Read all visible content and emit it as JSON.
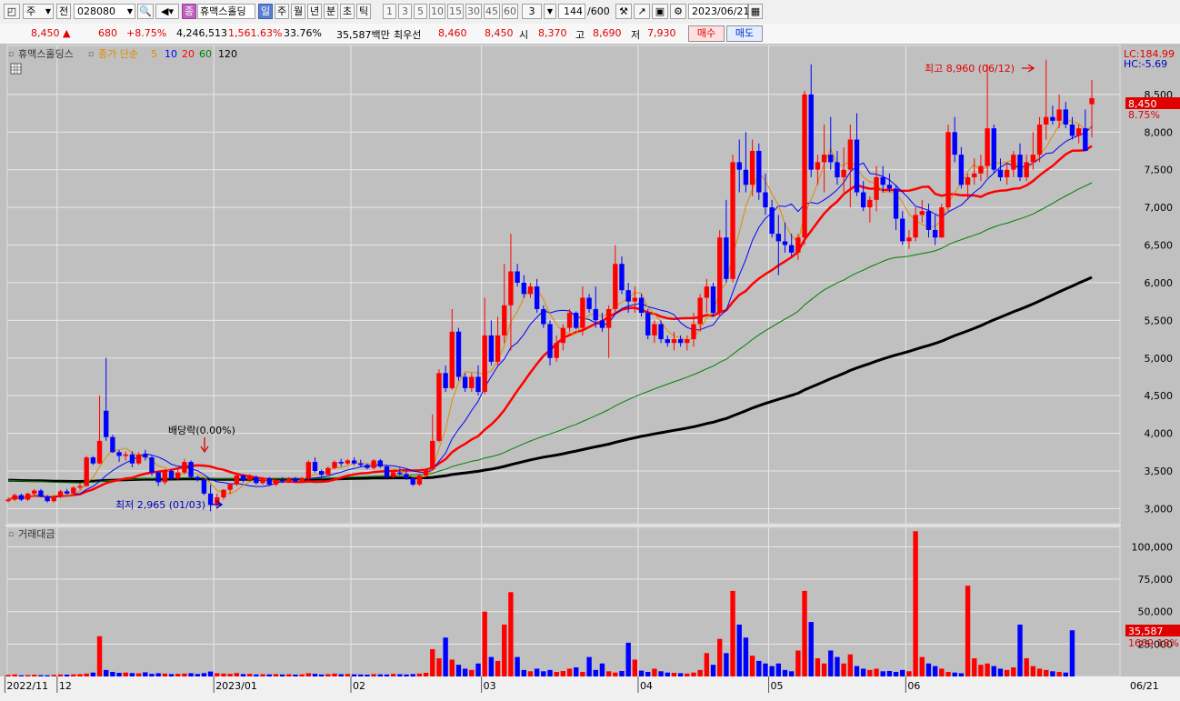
{
  "toolbar": {
    "market": "주",
    "prev_label": "전",
    "stock_code": "028080",
    "stock_badge": "종",
    "stock_name": "휴맥스홀딩",
    "periods": [
      "일",
      "주",
      "월",
      "년",
      "분",
      "초",
      "틱"
    ],
    "active_period": "일",
    "minute_steps": [
      "1",
      "3",
      "5",
      "10",
      "15",
      "30",
      "45",
      "60"
    ],
    "extra_step": "3",
    "count_value": "144",
    "count_total": "/600",
    "date": "2023/06/21"
  },
  "quote": {
    "price": "8,450",
    "arrow": "▲",
    "change": "680",
    "change_pct": "+8.75%",
    "volume": "4,246,513",
    "volume_ratio": "1,561.63%",
    "turnover": "33.76%",
    "amount": "35,587백만",
    "best_label": "최우선",
    "best_ask": "8,460",
    "best_bid": "8,450",
    "open_label": "시",
    "open": "8,370",
    "high_label": "고",
    "high": "8,690",
    "low_label": "저",
    "low": "7,930",
    "buy_label": "매수",
    "sell_label": "매도"
  },
  "price_panel": {
    "stock_name": "휴맥스홀딩스",
    "ma_label": "종가 단순",
    "ma_periods": [
      "5",
      "10",
      "20",
      "60",
      "120"
    ],
    "lc_label": "LC:184.99",
    "hc_label": "HC:-5.69",
    "last_price_tag": "8,450",
    "last_pct_tag": "8.75%",
    "max_annotation": "최고 8,960 (06/12)",
    "min_annotation": "최저 2,965 (01/03)",
    "dividend_annotation": "배당락(0.00%)",
    "y_ticks": [
      "3,000",
      "3,500",
      "4,000",
      "4,500",
      "5,000",
      "5,500",
      "6,000",
      "6,500",
      "7,000",
      "7,500",
      "8,000",
      "8,500"
    ]
  },
  "volume_panel": {
    "title": "거래대금",
    "y_ticks": [
      "25,000",
      "50,000",
      "75,000",
      "100,000"
    ],
    "last_tag": "35,587",
    "last_pct": "1669.18%"
  },
  "x_axis": {
    "labels": [
      "2022/11",
      "12",
      "2023/01",
      "02",
      "03",
      "04",
      "05",
      "06"
    ],
    "right_label": "06/21"
  },
  "colors": {
    "up": "#ff0000",
    "down": "#0000ff",
    "ma5": "#e08a00",
    "ma10": "#0000ff",
    "ma20": "#ff0000",
    "ma60": "#008000",
    "ma120": "#000000",
    "background": "#c0c0c0"
  },
  "chart_data": [
    {
      "type": "candlestick",
      "title": "휴맥스홀딩스",
      "ylim": [
        2800,
        9150
      ],
      "y_ticks": [
        3000,
        3500,
        4000,
        4500,
        5000,
        5500,
        6000,
        6500,
        7000,
        7500,
        8000,
        8500
      ],
      "x_labels": [
        "2022/11",
        "12",
        "2023/01",
        "02",
        "03",
        "04",
        "05",
        "06"
      ],
      "x_label_candle_index": [
        0,
        8,
        32,
        53,
        73,
        97,
        117,
        138
      ],
      "candles": [
        [
          3100,
          3150,
          3080,
          3120
        ],
        [
          3120,
          3200,
          3100,
          3180
        ],
        [
          3180,
          3200,
          3100,
          3120
        ],
        [
          3120,
          3210,
          3100,
          3200
        ],
        [
          3200,
          3260,
          3180,
          3240
        ],
        [
          3240,
          3260,
          3150,
          3160
        ],
        [
          3160,
          3180,
          3080,
          3100
        ],
        [
          3100,
          3180,
          3080,
          3160
        ],
        [
          3160,
          3250,
          3140,
          3230
        ],
        [
          3230,
          3260,
          3190,
          3200
        ],
        [
          3200,
          3300,
          3180,
          3280
        ],
        [
          3280,
          3340,
          3250,
          3300
        ],
        [
          3300,
          3700,
          3290,
          3680
        ],
        [
          3680,
          3700,
          3580,
          3600
        ],
        [
          3600,
          4500,
          3590,
          3900
        ],
        [
          4300,
          5000,
          3900,
          3950
        ],
        [
          3950,
          3980,
          3740,
          3750
        ],
        [
          3750,
          3780,
          3620,
          3700
        ],
        [
          3700,
          3760,
          3640,
          3720
        ],
        [
          3720,
          3760,
          3550,
          3600
        ],
        [
          3600,
          3750,
          3580,
          3720
        ],
        [
          3720,
          3780,
          3640,
          3680
        ],
        [
          3680,
          3700,
          3440,
          3480
        ],
        [
          3480,
          3500,
          3300,
          3350
        ],
        [
          3350,
          3520,
          3320,
          3500
        ],
        [
          3500,
          3520,
          3380,
          3400
        ],
        [
          3400,
          3520,
          3380,
          3480
        ],
        [
          3480,
          3660,
          3460,
          3620
        ],
        [
          3620,
          3640,
          3400,
          3420
        ],
        [
          3420,
          3440,
          3360,
          3390
        ],
        [
          3390,
          3400,
          3180,
          3200
        ],
        [
          3200,
          3320,
          2965,
          3050
        ],
        [
          3050,
          3200,
          3000,
          3150
        ],
        [
          3150,
          3260,
          3120,
          3250
        ],
        [
          3250,
          3340,
          3200,
          3320
        ],
        [
          3320,
          3460,
          3300,
          3440
        ],
        [
          3440,
          3460,
          3350,
          3380
        ],
        [
          3380,
          3460,
          3360,
          3420
        ],
        [
          3420,
          3440,
          3320,
          3340
        ],
        [
          3340,
          3420,
          3320,
          3400
        ],
        [
          3400,
          3420,
          3300,
          3320
        ],
        [
          3320,
          3400,
          3300,
          3380
        ],
        [
          3380,
          3420,
          3340,
          3360
        ],
        [
          3360,
          3420,
          3340,
          3400
        ],
        [
          3400,
          3420,
          3350,
          3360
        ],
        [
          3360,
          3420,
          3340,
          3400
        ],
        [
          3400,
          3640,
          3380,
          3620
        ],
        [
          3620,
          3680,
          3480,
          3500
        ],
        [
          3500,
          3520,
          3420,
          3450
        ],
        [
          3450,
          3560,
          3430,
          3540
        ],
        [
          3540,
          3640,
          3520,
          3620
        ],
        [
          3620,
          3660,
          3560,
          3600
        ],
        [
          3600,
          3660,
          3580,
          3640
        ],
        [
          3640,
          3680,
          3580,
          3600
        ],
        [
          3600,
          3650,
          3560,
          3580
        ],
        [
          3580,
          3600,
          3520,
          3540
        ],
        [
          3540,
          3660,
          3520,
          3640
        ],
        [
          3640,
          3660,
          3540,
          3560
        ],
        [
          3560,
          3580,
          3400,
          3420
        ],
        [
          3420,
          3500,
          3400,
          3480
        ],
        [
          3480,
          3540,
          3440,
          3460
        ],
        [
          3460,
          3500,
          3380,
          3400
        ],
        [
          3400,
          3420,
          3300,
          3320
        ],
        [
          3320,
          3460,
          3300,
          3440
        ],
        [
          3440,
          3540,
          3420,
          3520
        ],
        [
          3520,
          4250,
          3500,
          3900
        ],
        [
          3900,
          4850,
          3880,
          4800
        ],
        [
          4800,
          4900,
          4550,
          4600
        ],
        [
          4600,
          5650,
          4580,
          5350
        ],
        [
          5350,
          5400,
          4700,
          4750
        ],
        [
          4750,
          4800,
          4550,
          4600
        ],
        [
          4600,
          4800,
          4550,
          4750
        ],
        [
          4750,
          4900,
          4500,
          4550
        ],
        [
          4550,
          5800,
          4520,
          5300
        ],
        [
          5300,
          5500,
          4900,
          4950
        ],
        [
          4950,
          5550,
          4900,
          5300
        ],
        [
          5300,
          6250,
          5200,
          5700
        ],
        [
          5700,
          6650,
          5100,
          6150
        ],
        [
          6150,
          6250,
          5950,
          6000
        ],
        [
          6000,
          6100,
          5800,
          5850
        ],
        [
          5850,
          6000,
          5800,
          5950
        ],
        [
          5950,
          6050,
          5600,
          5650
        ],
        [
          5650,
          5700,
          5400,
          5450
        ],
        [
          5450,
          5500,
          4900,
          5000
        ],
        [
          5000,
          5300,
          4950,
          5200
        ],
        [
          5200,
          5450,
          5100,
          5400
        ],
        [
          5400,
          5650,
          5350,
          5600
        ],
        [
          5600,
          5620,
          5380,
          5400
        ],
        [
          5400,
          5950,
          5300,
          5800
        ],
        [
          5800,
          5850,
          5600,
          5650
        ],
        [
          5650,
          5950,
          5400,
          5500
        ],
        [
          5500,
          5600,
          5350,
          5400
        ],
        [
          5400,
          5700,
          5000,
          5650
        ],
        [
          5650,
          6500,
          5600,
          6250
        ],
        [
          6250,
          6350,
          5850,
          5900
        ],
        [
          5900,
          6000,
          5600,
          5750
        ],
        [
          5750,
          5950,
          5600,
          5800
        ],
        [
          5800,
          5850,
          5550,
          5600
        ],
        [
          5600,
          5650,
          5250,
          5300
        ],
        [
          5300,
          5500,
          5200,
          5450
        ],
        [
          5450,
          5500,
          5200,
          5250
        ],
        [
          5250,
          5300,
          5150,
          5200
        ],
        [
          5200,
          5350,
          5100,
          5250
        ],
        [
          5250,
          5300,
          5150,
          5200
        ],
        [
          5200,
          5300,
          5100,
          5250
        ],
        [
          5250,
          5600,
          5150,
          5450
        ],
        [
          5450,
          5850,
          5350,
          5800
        ],
        [
          5800,
          6050,
          5600,
          5950
        ],
        [
          5950,
          6000,
          5550,
          5600
        ],
        [
          5600,
          6700,
          5550,
          6600
        ],
        [
          6600,
          7100,
          6000,
          6050
        ],
        [
          6050,
          7700,
          6000,
          7600
        ],
        [
          7600,
          7900,
          7200,
          7500
        ],
        [
          7500,
          8000,
          7200,
          7300
        ],
        [
          7300,
          7900,
          7150,
          7750
        ],
        [
          7750,
          7850,
          7100,
          7200
        ],
        [
          7200,
          7450,
          6900,
          7000
        ],
        [
          7000,
          7100,
          6600,
          6650
        ],
        [
          6650,
          6900,
          6100,
          6550
        ],
        [
          6550,
          6800,
          6400,
          6500
        ],
        [
          6500,
          6650,
          6350,
          6400
        ],
        [
          6400,
          6650,
          6300,
          6600
        ],
        [
          6600,
          8550,
          6500,
          8500
        ],
        [
          8500,
          8900,
          7400,
          7500
        ],
        [
          7500,
          7700,
          7300,
          7600
        ],
        [
          7600,
          8100,
          7200,
          7700
        ],
        [
          7700,
          8200,
          7500,
          7600
        ],
        [
          7600,
          7750,
          7300,
          7400
        ],
        [
          7400,
          7800,
          7200,
          7500
        ],
        [
          7500,
          8100,
          7000,
          7900
        ],
        [
          7900,
          8250,
          7150,
          7200
        ],
        [
          7200,
          7350,
          6950,
          7000
        ],
        [
          7000,
          7150,
          6800,
          7100
        ],
        [
          7100,
          7550,
          6950,
          7400
        ],
        [
          7400,
          7550,
          7200,
          7300
        ],
        [
          7300,
          7450,
          7200,
          7250
        ],
        [
          7250,
          7300,
          6700,
          6850
        ],
        [
          6850,
          6950,
          6500,
          6550
        ],
        [
          6550,
          6700,
          6450,
          6600
        ],
        [
          6600,
          7000,
          6550,
          6900
        ],
        [
          6900,
          7100,
          6800,
          6950
        ],
        [
          6950,
          7050,
          6600,
          6700
        ],
        [
          6700,
          6900,
          6500,
          6600
        ],
        [
          6600,
          7050,
          6600,
          7000
        ],
        [
          7000,
          8100,
          6950,
          8000
        ],
        [
          8000,
          8200,
          7600,
          7700
        ],
        [
          7700,
          7800,
          7250,
          7300
        ],
        [
          7300,
          7450,
          7100,
          7400
        ],
        [
          7400,
          7650,
          7300,
          7450
        ],
        [
          7450,
          7700,
          7350,
          7550
        ],
        [
          7550,
          8900,
          7400,
          8050
        ],
        [
          8050,
          8100,
          7450,
          7500
        ],
        [
          7500,
          7650,
          7350,
          7400
        ],
        [
          7400,
          7600,
          7300,
          7500
        ],
        [
          7500,
          7750,
          7400,
          7700
        ],
        [
          7700,
          7850,
          7350,
          7400
        ],
        [
          7400,
          7700,
          7350,
          7600
        ],
        [
          7600,
          8000,
          7500,
          7700
        ],
        [
          7700,
          8200,
          7600,
          8100
        ],
        [
          8100,
          8960,
          7900,
          8200
        ],
        [
          8200,
          8350,
          8100,
          8150
        ],
        [
          8150,
          8500,
          8050,
          8300
        ],
        [
          8300,
          8400,
          8050,
          8100
        ],
        [
          8100,
          8200,
          7900,
          7950
        ],
        [
          7950,
          8100,
          7850,
          8050
        ],
        [
          8050,
          8300,
          7750,
          7750
        ],
        [
          8370,
          8690,
          7930,
          8450
        ]
      ]
    },
    {
      "type": "bar",
      "title": "거래대금",
      "ylim": [
        0,
        115000
      ],
      "values": [
        1200,
        1500,
        900,
        1100,
        1300,
        1000,
        900,
        1200,
        1500,
        1400,
        1600,
        1800,
        2200,
        3000,
        31000,
        5000,
        3500,
        2800,
        3000,
        2600,
        2400,
        3200,
        2000,
        2500,
        2200,
        1800,
        2000,
        2200,
        2500,
        1900,
        2600,
        3800,
        2500,
        2200,
        2000,
        2600,
        1800,
        2000,
        1500,
        1700,
        1600,
        1800,
        1500,
        1700,
        1400,
        1600,
        2500,
        2000,
        1500,
        1800,
        2200,
        1700,
        1900,
        1600,
        1500,
        1400,
        1800,
        1600,
        1500,
        2000,
        1700,
        1500,
        1800,
        2200,
        2800,
        21000,
        14000,
        30000,
        13000,
        9000,
        6000,
        5000,
        10000,
        50000,
        15000,
        12000,
        40000,
        65000,
        15000,
        5000,
        4000,
        6000,
        4000,
        5000,
        3500,
        4200,
        6000,
        7000,
        3500,
        15000,
        5000,
        10000,
        4000,
        3000,
        4200,
        26000,
        13000,
        4500,
        3500,
        6000,
        4000,
        3000,
        2800,
        2500,
        2200,
        3000,
        5000,
        18000,
        9000,
        29000,
        18000,
        66000,
        40000,
        30000,
        16000,
        12000,
        10000,
        8000,
        10000,
        5000,
        4000,
        20000,
        66000,
        42000,
        14000,
        10000,
        20000,
        15000,
        10000,
        17000,
        8000,
        6000,
        5000,
        6000,
        4000,
        4200,
        3500,
        5000,
        4000,
        112000,
        15000,
        10000,
        8000,
        6000,
        3500,
        3000,
        2500,
        70000,
        14000,
        9000,
        10000,
        8000,
        6000,
        5000,
        7000,
        40000,
        14000,
        8000,
        6000,
        5000,
        4000,
        3500,
        3000,
        35587
      ]
    }
  ]
}
